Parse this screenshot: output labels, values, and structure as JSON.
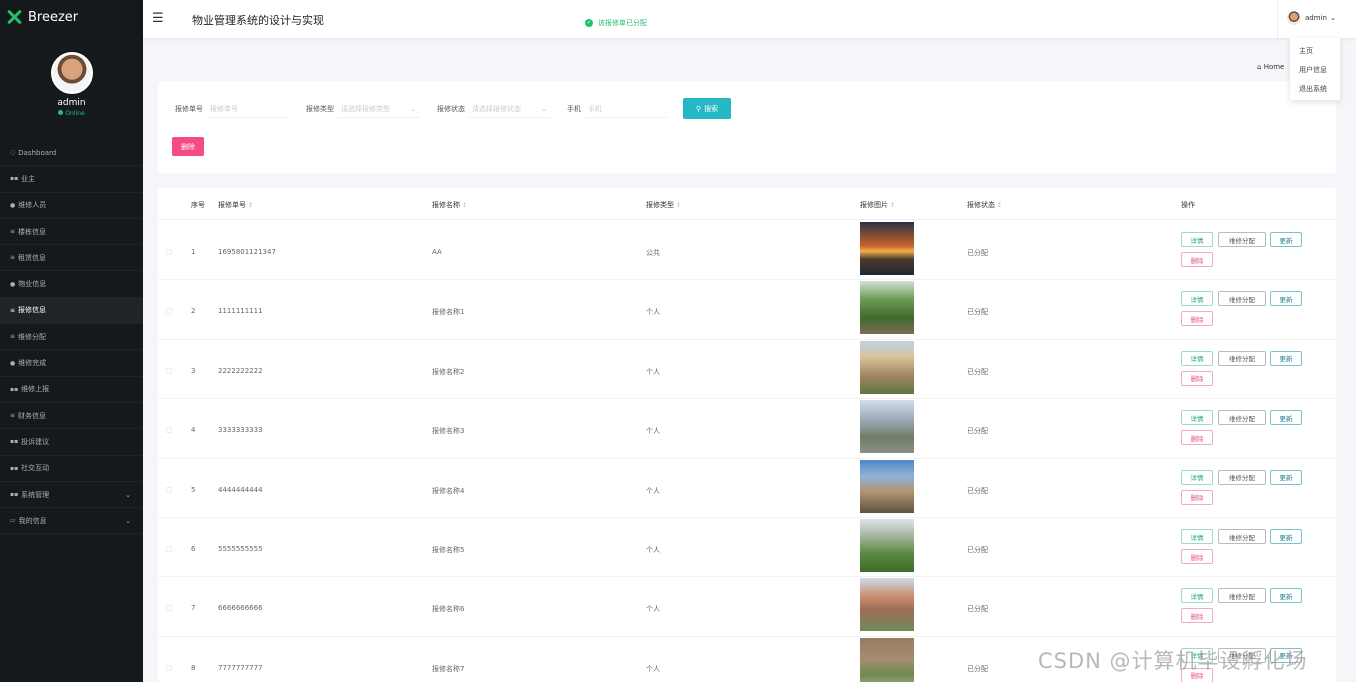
{
  "brand": {
    "name": "Breezer",
    "accent": "#21c06e"
  },
  "user": {
    "name": "admin",
    "status": "Online"
  },
  "sidebar": {
    "items": [
      {
        "label": "Dashboard",
        "icon": "dashboard-icon",
        "glyph": "◌"
      },
      {
        "label": "业主",
        "icon": "grid-icon",
        "glyph": "▪▪"
      },
      {
        "label": "维修人员",
        "icon": "user-icon",
        "glyph": "●"
      },
      {
        "label": "楼栋信息",
        "icon": "list-icon",
        "glyph": "≡"
      },
      {
        "label": "租赁信息",
        "icon": "list-icon",
        "glyph": "≡"
      },
      {
        "label": "物业信息",
        "icon": "pin-icon",
        "glyph": "●"
      },
      {
        "label": "报修信息",
        "icon": "list-icon",
        "glyph": "≡",
        "active": true
      },
      {
        "label": "维修分配",
        "icon": "list-icon",
        "glyph": "≡"
      },
      {
        "label": "维修完成",
        "icon": "user-icon",
        "glyph": "●"
      },
      {
        "label": "维修上报",
        "icon": "grid-icon",
        "glyph": "▪▪"
      },
      {
        "label": "财务信息",
        "icon": "list-icon",
        "glyph": "≡"
      },
      {
        "label": "投诉建议",
        "icon": "grid-icon",
        "glyph": "▪▪"
      },
      {
        "label": "社交互动",
        "icon": "grid-icon",
        "glyph": "▪▪"
      },
      {
        "label": "系统管理",
        "icon": "grid-icon",
        "glyph": "▪▪",
        "caret": true
      },
      {
        "label": "我的信息",
        "icon": "card-icon",
        "glyph": "▭",
        "caret": true
      }
    ]
  },
  "header": {
    "title": "物业管理系统的设计与实现",
    "toast": "该报修单已分配",
    "user_label": "admin"
  },
  "dropdown": {
    "items": [
      "主页",
      "用户信息",
      "退出系统"
    ]
  },
  "breadcrumb": {
    "label": "Home"
  },
  "search": {
    "fields": [
      {
        "label": "报修单号",
        "placeholder": "报修单号"
      },
      {
        "label": "报修类型",
        "placeholder": "请选择报修类型"
      },
      {
        "label": "报修状态",
        "placeholder": "请选择报修状态"
      },
      {
        "label": "手机",
        "placeholder": "手机"
      }
    ],
    "button": "搜索",
    "delete_button": "删除"
  },
  "table": {
    "headers": {
      "index": "序号",
      "number": "报修单号",
      "name": "报修名称",
      "type": "报修类型",
      "image": "报修图片",
      "status": "报修状态",
      "actions": "操作"
    },
    "action_labels": {
      "detail": "详情",
      "assign": "维修分配",
      "update": "更新",
      "delete": "删除"
    },
    "rows": [
      {
        "index": "1",
        "number": "1695801121347",
        "name": "AA",
        "type": "公共",
        "status": "已分配",
        "image": "sunset-photo"
      },
      {
        "index": "2",
        "number": "1111111111",
        "name": "报修名称1",
        "type": "个人",
        "status": "已分配",
        "image": "garden-photo"
      },
      {
        "index": "3",
        "number": "2222222222",
        "name": "报修名称2",
        "type": "个人",
        "status": "已分配",
        "image": "building-photo"
      },
      {
        "index": "4",
        "number": "3333333333",
        "name": "报修名称3",
        "type": "个人",
        "status": "已分配",
        "image": "street-photo"
      },
      {
        "index": "5",
        "number": "4444444444",
        "name": "报修名称4",
        "type": "个人",
        "status": "已分配",
        "image": "plaza-photo"
      },
      {
        "index": "6",
        "number": "5555555555",
        "name": "报修名称5",
        "type": "个人",
        "status": "已分配",
        "image": "courtyard-photo"
      },
      {
        "index": "7",
        "number": "6666666666",
        "name": "报修名称6",
        "type": "个人",
        "status": "已分配",
        "image": "tower-photo"
      },
      {
        "index": "8",
        "number": "7777777777",
        "name": "报修名称7",
        "type": "个人",
        "status": "已分配",
        "image": "path-photo"
      }
    ]
  },
  "watermark": "CSDN @计算机毕设孵化场"
}
